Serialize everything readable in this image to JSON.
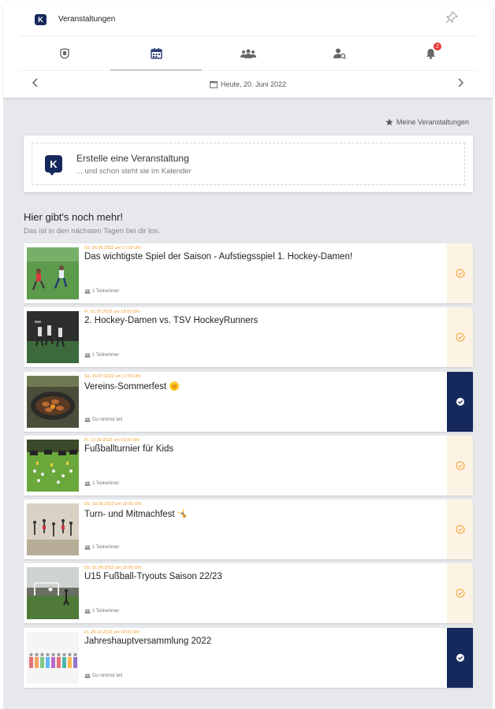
{
  "header": {
    "app_title": "Veranstaltungen",
    "date_label": "Heute, 20. Juni 2022",
    "tabs": [
      {
        "icon": "shield-icon"
      },
      {
        "icon": "calendar-icon",
        "active": true
      },
      {
        "icon": "group-icon"
      },
      {
        "icon": "user-search-icon"
      },
      {
        "icon": "bell-icon",
        "badge": "2"
      }
    ]
  },
  "my_events_link": "Meine Veranstaltungen",
  "create": {
    "title": "Erstelle eine Veranstaltung",
    "subtitle": "... und schon steht sie im Kalender"
  },
  "section": {
    "title": "Hier gibt's noch mehr!",
    "subtitle": "Das ist in den nächsten Tagen bei dir los."
  },
  "events": [
    {
      "date": "So. 26.06.2022 um 17:00 Uhr",
      "title": "Das wichtigste Spiel der Saison - Aufstiegsspiel 1. Hockey-Damen!",
      "meta": "1 Teilnehmer",
      "status": "open"
    },
    {
      "date": "Fr. 01.07.2022 um 19:00 Uhr",
      "title": "2. Hockey-Damen vs. TSV HockeyRunners",
      "meta": "1 Teilnehmer",
      "status": "open"
    },
    {
      "date": "Sa. 09.07.2022 um 17:00 Uhr",
      "title": "Vereins-Sommerfest 🌞",
      "meta": "Du nimmst teil",
      "status": "joined"
    },
    {
      "date": "Fr. 12.08.2022 um 16:00 Uhr",
      "title": "Fußballturnier für Kids",
      "meta": "1 Teilnehmer",
      "status": "open"
    },
    {
      "date": "Do. 18.08.2022 um 18:00 Uhr",
      "title": "Turn- und Mitmachfest 🤸",
      "meta": "1 Teilnehmer",
      "status": "open"
    },
    {
      "date": "Do. 01.09.2022 um 15:00 Uhr",
      "title": "U15 Fußball-Tryouts Saison 22/23",
      "meta": "1 Teilnehmer",
      "status": "open"
    },
    {
      "date": "Fr. 28.10.2022 um 18:00 Uhr",
      "title": "Jahreshauptversammlung 2022",
      "meta": "Du nimmst teil",
      "status": "joined"
    }
  ],
  "colors": {
    "accent": "#16295c",
    "date": "#f0a030",
    "pending_bg": "#fdf3e4"
  }
}
